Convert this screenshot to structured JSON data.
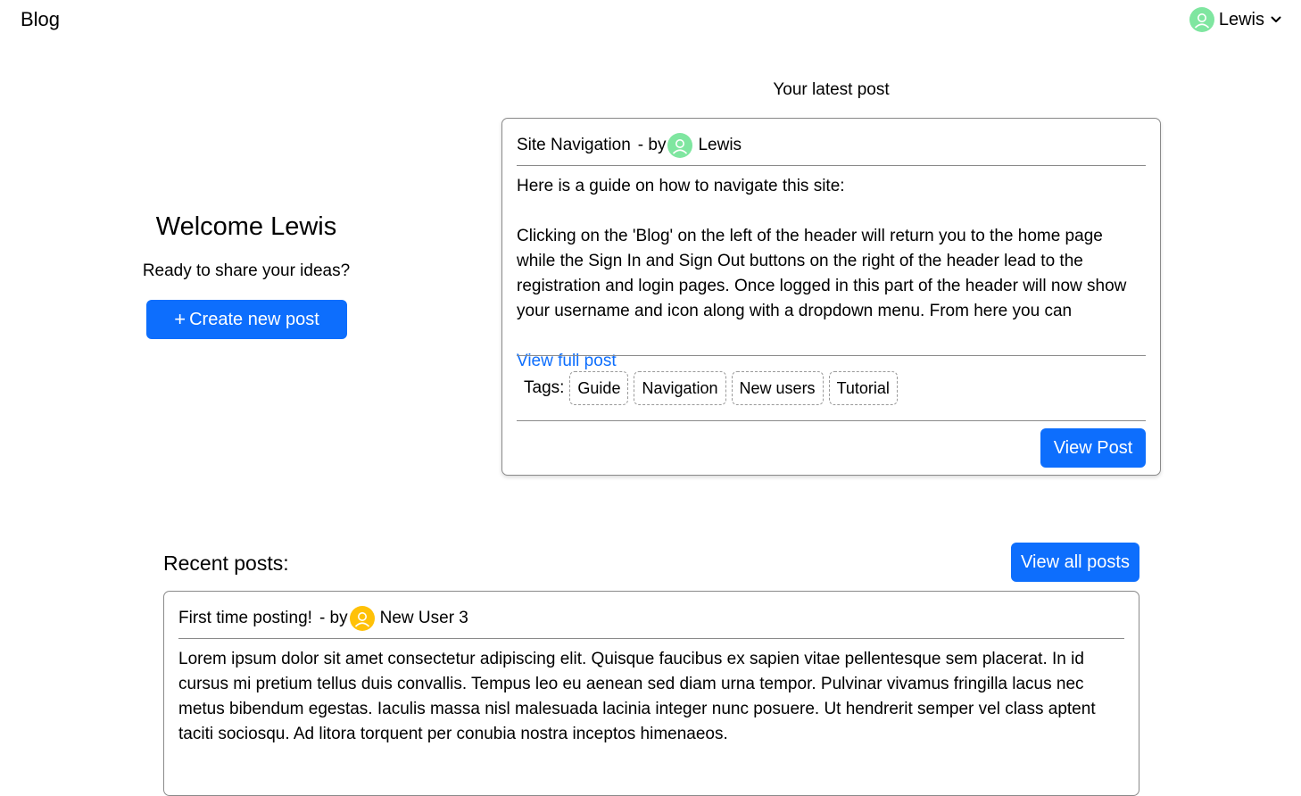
{
  "header": {
    "brand": "Blog",
    "user_name": "Lewis",
    "user_avatar_color": "#7fe6a0"
  },
  "welcome": {
    "title": "Welcome Lewis",
    "subtitle": "Ready to share your ideas?",
    "create_button_label": "Create new post"
  },
  "latest": {
    "heading": "Your latest post",
    "title": "Site Navigation",
    "by": "- by",
    "author": "Lewis",
    "author_avatar_color": "#7fe6a0",
    "body": "Here is a guide on how to navigate this site:\n\nClicking on the 'Blog' on the left of the header will return you to the home page while the Sign In and Sign Out buttons on the right of the header lead to the registration and login pages. Once logged in this part of the header will now show your username and icon along with a dropdown menu. From here you can",
    "view_full_label": "View full post",
    "tags_label": "Tags:",
    "tags": [
      "Guide",
      "Navigation",
      "New users",
      "Tutorial"
    ],
    "view_post_label": "View Post"
  },
  "recent": {
    "title": "Recent posts:",
    "view_all_label": "View all posts",
    "posts": [
      {
        "title": "First time posting!",
        "by": "- by",
        "author": "New User 3",
        "author_avatar_color": "#ffc107",
        "body": "Lorem ipsum dolor sit amet consectetur adipiscing elit. Quisque faucibus ex sapien vitae pellentesque sem placerat. In id cursus mi pretium tellus duis convallis. Tempus leo eu aenean sed diam urna tempor. Pulvinar vivamus fringilla lacus nec metus bibendum egestas. Iaculis massa nisl malesuada lacinia integer nunc posuere. Ut hendrerit semper vel class aptent taciti sociosqu. Ad litora torquent per conubia nostra inceptos himenaeos."
      }
    ]
  },
  "colors": {
    "primary": "#0d6efd",
    "border": "#8a8a8a"
  }
}
